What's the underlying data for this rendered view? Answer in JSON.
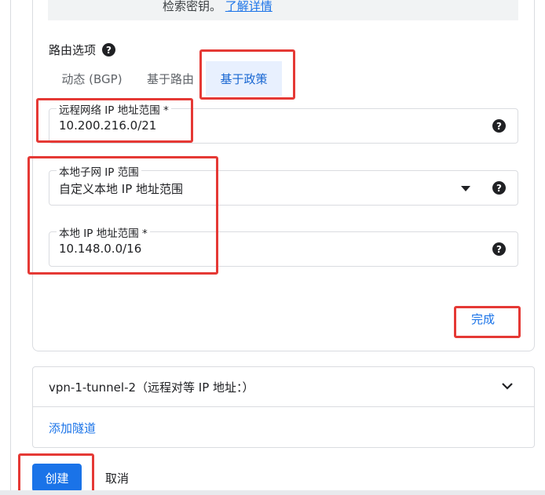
{
  "note": {
    "text": "检索密钥。",
    "link": "了解详情"
  },
  "routing": {
    "label": "路由选项",
    "tabs": [
      "动态 (BGP)",
      "基于路由",
      "基于政策"
    ],
    "selected_tab": "基于政策"
  },
  "fields": {
    "remote_range": {
      "label": "远程网络 IP 地址范围 *",
      "value": "10.200.216.0/21"
    },
    "local_subnet": {
      "label": "本地子网 IP 范围",
      "value": "自定义本地 IP 地址范围"
    },
    "local_range": {
      "label": "本地 IP 地址范围 *",
      "value": "10.148.0.0/16"
    }
  },
  "done_label": "完成",
  "tunnel": {
    "label": "vpn-1-tunnel-2（远程对等 IP 地址：）"
  },
  "add_tunnel_label": "添加隧道",
  "actions": {
    "create_label": "创建",
    "cancel_label": "取消"
  },
  "colors": {
    "accent": "#1a73e8",
    "annotation": "#e53935",
    "selected_tab_bg": "#e8f0fe"
  },
  "icons": {
    "help": "help-circle-icon",
    "dropdown": "caret-down-icon",
    "expand": "chevron-down-icon"
  }
}
